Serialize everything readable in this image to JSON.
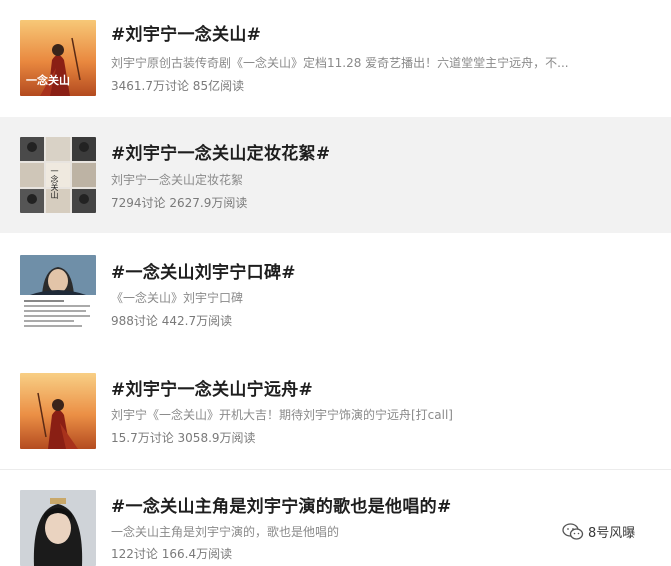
{
  "topics": [
    {
      "title": "#刘宇宁一念关山#",
      "description": "刘宇宁原创古装传奇剧《一念关山》定档11.28 爱奇艺播出！六道堂堂主宁远舟，不...",
      "stats": "3461.7万讨论 85亿阅读",
      "thumb_icon": "poster-red-warrior-thumbnail",
      "thumb_logo": "一念关山"
    },
    {
      "title": "#刘宇宁一念关山定妆花絮#",
      "description": "刘宇宁一念关山定妆花絮",
      "stats": "7294讨论 2627.9万阅读",
      "thumb_icon": "costume-collage-thumbnail",
      "thumb_logo": "一念关山"
    },
    {
      "title": "#一念关山刘宇宁口碑#",
      "description": "《一念关山》刘宇宁口碑",
      "stats": "988讨论 442.7万阅读",
      "thumb_icon": "portrait-text-post-thumbnail"
    },
    {
      "title": "#刘宇宁一念关山宁远舟#",
      "description": "刘宇宁《一念关山》开机大吉！期待刘宇宁饰演的宁远舟[打call]",
      "stats": "15.7万讨论 3058.9万阅读",
      "thumb_icon": "poster-red-warrior-thumbnail"
    },
    {
      "title": "#一念关山主角是刘宇宁演的歌也是他唱的#",
      "description": "一念关山主角是刘宇宁演的，歌也是他唱的",
      "stats": "122讨论 166.4万阅读",
      "thumb_icon": "actor-portrait-thumbnail"
    }
  ],
  "watermark": {
    "text": "8号风曝",
    "icon": "wechat-icon"
  },
  "colors": {
    "title": "#1e1e1e",
    "description": "#8a8a8a",
    "highlight_row": "#f2f2f2"
  }
}
